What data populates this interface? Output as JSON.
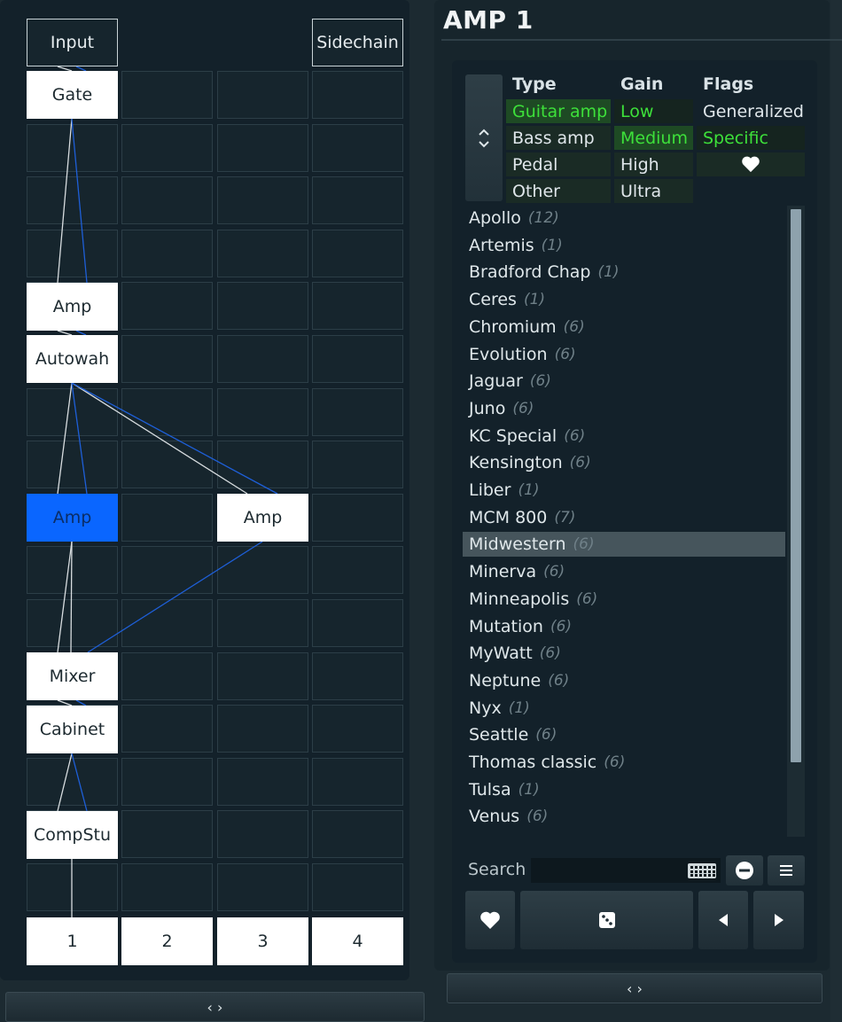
{
  "routing": {
    "input_label": "Input",
    "sidechain_label": "Sidechain",
    "nodes": {
      "gate": "Gate",
      "amp1": "Amp",
      "autowah": "Autowah",
      "amp2": "Amp",
      "amp3": "Amp",
      "mixer": "Mixer",
      "cabinet": "Cabinet",
      "compstu": "CompStu"
    },
    "columns": [
      "1",
      "2",
      "3",
      "4"
    ],
    "collapse_label": "‹ ›"
  },
  "module": {
    "title": "AMP 1",
    "collapse_label": "‹ ›"
  },
  "filters": {
    "spinner_icon": "chevron-up-down-icon",
    "type_header": "Type",
    "gain_header": "Gain",
    "flags_header": "Flags",
    "type": [
      "Guitar amp",
      "Bass amp",
      "Pedal",
      "Other"
    ],
    "gain": [
      "Low",
      "Medium",
      "High",
      "Ultra"
    ],
    "flags": [
      "Generalized",
      "Specific"
    ],
    "favorite_flag_icon": "heart-icon"
  },
  "presets": [
    {
      "name": "Apollo",
      "count": "(12)"
    },
    {
      "name": "Artemis",
      "count": "(1)"
    },
    {
      "name": "Bradford Chap",
      "count": "(1)"
    },
    {
      "name": "Ceres",
      "count": "(1)"
    },
    {
      "name": "Chromium",
      "count": "(6)"
    },
    {
      "name": "Evolution",
      "count": "(6)"
    },
    {
      "name": "Jaguar",
      "count": "(6)"
    },
    {
      "name": "Juno",
      "count": "(6)"
    },
    {
      "name": "KC Special",
      "count": "(6)"
    },
    {
      "name": "Kensington",
      "count": "(6)"
    },
    {
      "name": "Liber",
      "count": "(1)"
    },
    {
      "name": "MCM 800",
      "count": "(7)"
    },
    {
      "name": "Midwestern",
      "count": "(6)"
    },
    {
      "name": "Minerva",
      "count": "(6)"
    },
    {
      "name": "Minneapolis",
      "count": "(6)"
    },
    {
      "name": "Mutation",
      "count": "(6)"
    },
    {
      "name": "MyWatt",
      "count": "(6)"
    },
    {
      "name": "Neptune",
      "count": "(6)"
    },
    {
      "name": "Nyx",
      "count": "(1)"
    },
    {
      "name": "Seattle",
      "count": "(6)"
    },
    {
      "name": "Thomas classic",
      "count": "(6)"
    },
    {
      "name": "Tulsa",
      "count": "(1)"
    },
    {
      "name": "Venus",
      "count": "(6)"
    }
  ],
  "selected_preset": "Midwestern",
  "search": {
    "label": "Search",
    "value": ""
  },
  "colors": {
    "accent_blue": "#0a66ff",
    "active_green": "#3de03a",
    "wire_blue": "#1e5fd8",
    "wire_white": "#d8dde0"
  }
}
